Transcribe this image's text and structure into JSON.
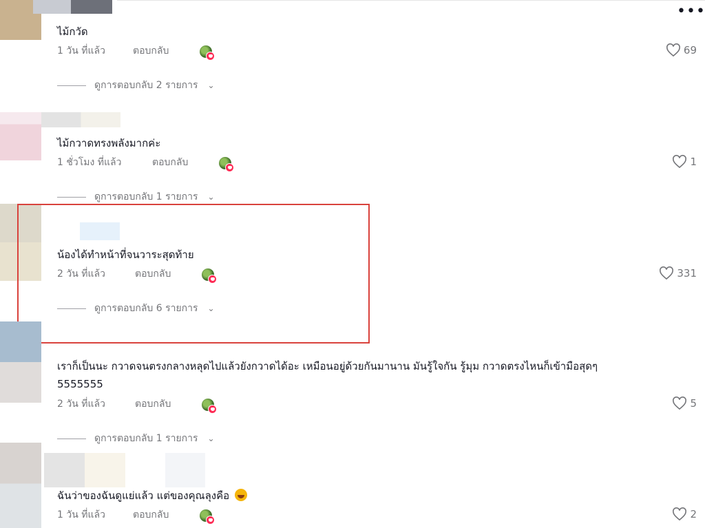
{
  "toolbar": {
    "more_label": "•••"
  },
  "comments": [
    {
      "text": "ไม้กวัด",
      "time": "1 วัน ที่แล้ว",
      "reply": "ตอบกลับ",
      "likes": "69",
      "view_replies": "ดูการตอบกลับ 2 รายการ"
    },
    {
      "text": "ไม้กวาดทรงพลังมากค่ะ",
      "time": "1 ชั่วโมง ที่แล้ว",
      "reply": "ตอบกลับ",
      "likes": "1",
      "view_replies": "ดูการตอบกลับ 1 รายการ"
    },
    {
      "text": "น้องได้ทำหน้าที่จนวาระสุดท้าย",
      "time": "2 วัน ที่แล้ว",
      "reply": "ตอบกลับ",
      "likes": "331",
      "view_replies": "ดูการตอบกลับ 6 รายการ"
    },
    {
      "text": "เราก็เป็นนะ กวาดจนตรงกลางหลุดไปแล้วยังกวาดได้อะ เหมือนอยู่ด้วยกันมานาน มันรู้ใจกัน รู้มุม กวาดตรงไหนก็เข้ามือสุดๆ",
      "text2": "5555555",
      "time": "2 วัน ที่แล้ว",
      "reply": "ตอบกลับ",
      "likes": "5",
      "view_replies": "ดูการตอบกลับ 1 รายการ"
    },
    {
      "text": "ฉันว่าของฉันดูแย่แล้ว แต่ของคุณลุงคือ",
      "emoji": "rofl-emoji",
      "time": "1 วัน ที่แล้ว",
      "reply": "ตอบกลับ",
      "likes": "2"
    }
  ],
  "icons": {
    "like": "heart-outline-icon",
    "chevron": "chevron-down-icon",
    "creator_like": "creator-liked-avatar-icon"
  },
  "colors": {
    "muted": "#75767a",
    "highlight": "#d9423c",
    "badge": "#fe2c55"
  }
}
